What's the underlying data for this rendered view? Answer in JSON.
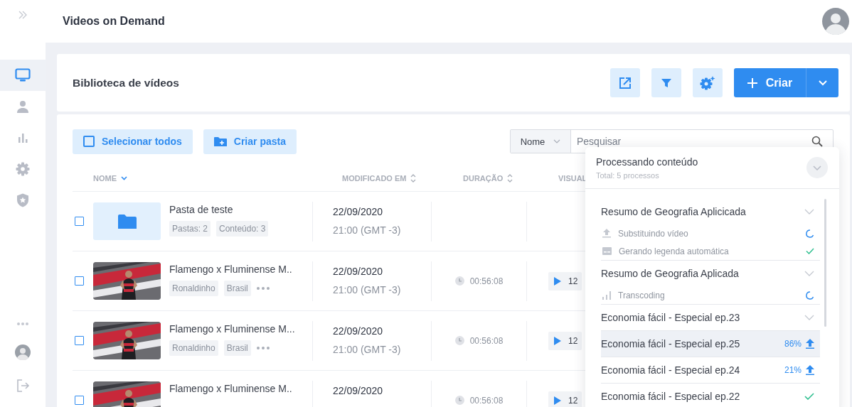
{
  "sidebar": {
    "items": [
      {
        "selected": true
      },
      {
        "selected": false
      },
      {
        "selected": false
      },
      {
        "selected": false
      },
      {
        "selected": false
      }
    ]
  },
  "header": {
    "title": "Videos on Demand"
  },
  "library": {
    "title": "Biblioteca de vídeos",
    "create_button": "Criar"
  },
  "toolbar": {
    "select_all": "Selecionar todos",
    "new_folder": "Criar pasta",
    "filter_field": "Nome",
    "search": {
      "placeholder": "Pesquisar"
    }
  },
  "table": {
    "columns": [
      {
        "label": "NOME",
        "sortable": true,
        "sorted": true
      },
      {
        "label": "MODIFICADO EM",
        "sortable": true,
        "sorted": false
      },
      {
        "label": "DURAÇÃO",
        "sortable": true,
        "sorted": false
      },
      {
        "label": "VISUAL"
      }
    ],
    "rows": [
      {
        "kind": "folder",
        "checked": false,
        "title": "Pasta de teste",
        "tags": [
          "Pastas: 2",
          "Conteúdo: 3"
        ],
        "date": "22/09/2020",
        "time": "21:00 (GMT -3)"
      },
      {
        "kind": "video",
        "checked": false,
        "title": "Flamengo x Fluminense M..",
        "tags": [
          "Ronaldinho",
          "Brasil"
        ],
        "more": true,
        "date": "22/09/2020",
        "time": "21:00 (GMT -3)",
        "duration": "00:56:08",
        "views": "12"
      },
      {
        "kind": "video",
        "checked": false,
        "title": "Flamengo x Fluminense M...",
        "tags": [
          "Ronaldinho",
          "Brasil"
        ],
        "more": true,
        "date": "22/09/2020",
        "time": "21:00 (GMT -3)",
        "duration": "00:56:08",
        "views": "12"
      },
      {
        "kind": "video",
        "checked": false,
        "title": "Flamengo x Fluminense M..",
        "date": "22/09/2020",
        "duration": "00:56:08",
        "views": "12"
      }
    ]
  },
  "processing": {
    "title": "Processando conteúdo",
    "subtitle": "Total: 5 processos",
    "items": [
      {
        "kind": "group",
        "selected": false,
        "title": "Resumo de Geografia Aplicicada",
        "steps": [
          {
            "kind": "upload",
            "label": "Substituindo vídeo",
            "done": false
          },
          {
            "kind": "subtitle",
            "label": "Gerando legenda automática",
            "done": true
          }
        ]
      },
      {
        "kind": "group",
        "selected": false,
        "title": "Resumo de Geografia Aplicada",
        "steps": [
          {
            "kind": "transcode",
            "label": "Transcoding",
            "done": false
          }
        ]
      },
      {
        "kind": "group",
        "selected": false,
        "title": "Economia fácil - Especial ep.23"
      },
      {
        "kind": "upload",
        "selected": true,
        "title": "Economia fácil - Especial ep.25",
        "progress": "86%"
      },
      {
        "kind": "upload",
        "selected": false,
        "title": "Economia fácil - Especial ep.24",
        "progress": "21%"
      },
      {
        "kind": "done",
        "selected": false,
        "title": "Economia fácil - Especial ep.22"
      }
    ]
  }
}
